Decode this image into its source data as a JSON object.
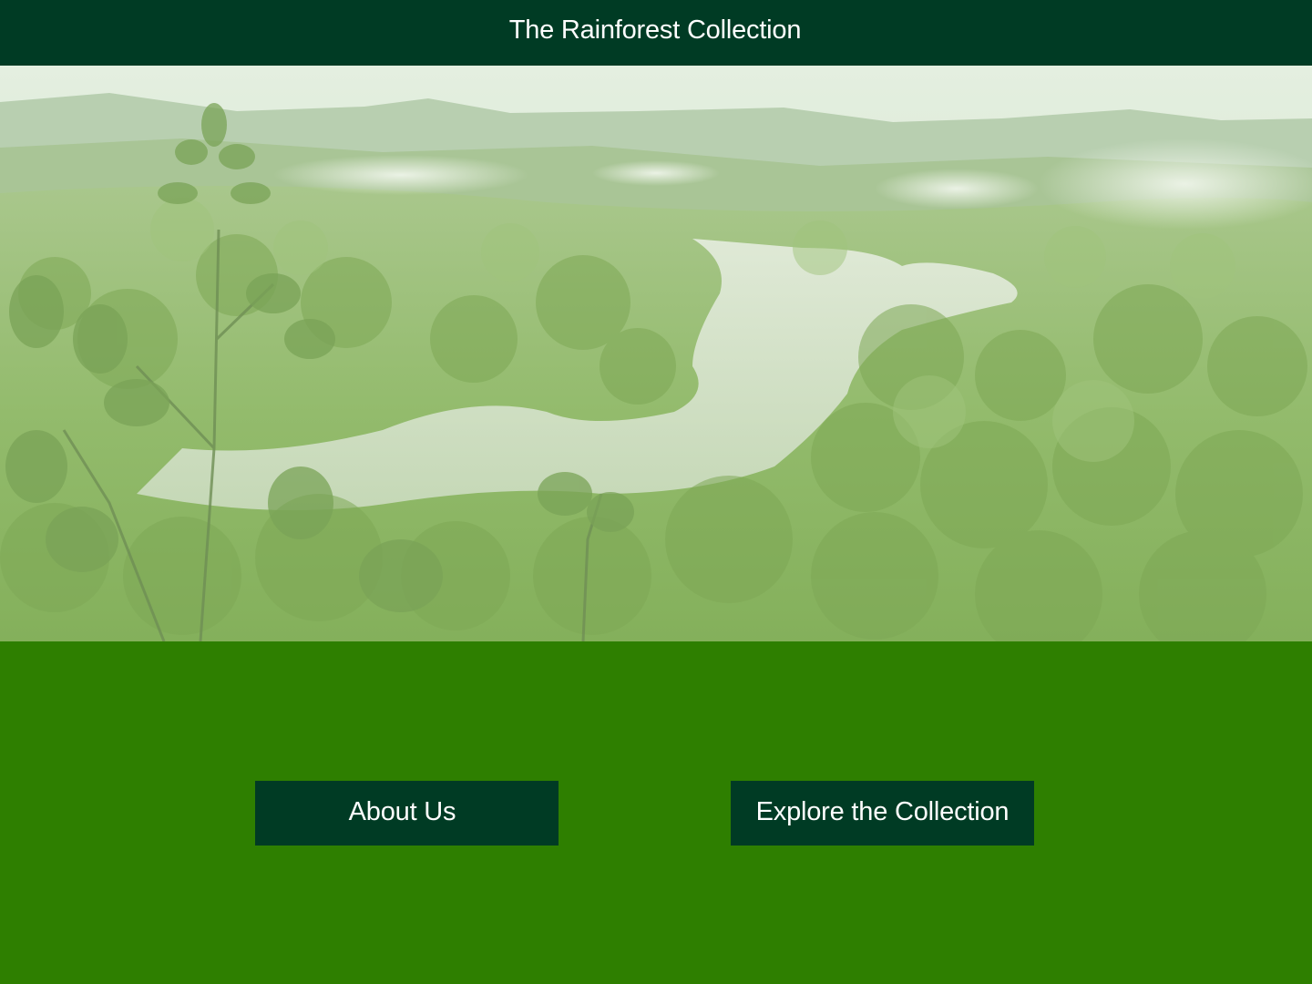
{
  "header": {
    "title": "The Rainforest Collection"
  },
  "hero": {
    "image_icon": "rainforest-landscape-image"
  },
  "actions": {
    "about_label": "About Us",
    "explore_label": "Explore the Collection"
  },
  "colors": {
    "header_bg": "#003b24",
    "button_bg": "#003b24",
    "panel_bg": "#2e7f00",
    "text": "#ffffff"
  }
}
